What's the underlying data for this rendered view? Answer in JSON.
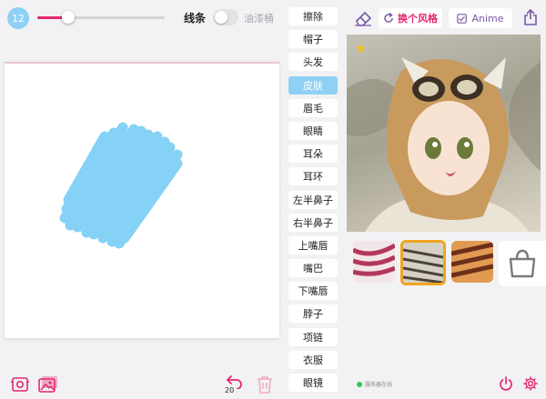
{
  "brush": {
    "size": "12",
    "size_fraction": 0.24,
    "accent": "#e4286e",
    "badge_color": "#8fd1f4"
  },
  "toolbar": {
    "lines_label": "线条",
    "paint_label": "油漆桶",
    "lines_toggle_on": false,
    "undo_count": "20"
  },
  "parts": {
    "active_index": 3,
    "items": [
      "擦除",
      "帽子",
      "头发",
      "皮肤",
      "眉毛",
      "眼睛",
      "耳朵",
      "耳环",
      "左半鼻子",
      "右半鼻子",
      "上嘴唇",
      "嘴巴",
      "下嘴唇",
      "脖子",
      "项链",
      "衣服",
      "眼镜"
    ]
  },
  "style_bar": {
    "change_style_label": "换个风格",
    "anime_label": "Anime"
  },
  "styles": {
    "selected_index": 1
  },
  "status": {
    "text": "服务器在线",
    "color": "#34c759"
  },
  "icons": {
    "top": [
      "eraser-icon",
      "refresh-icon",
      "checkbox-icon",
      "share-icon"
    ],
    "bottom": [
      "camera-icon",
      "gallery-icon",
      "undo-icon",
      "trash-icon",
      "power-icon",
      "gear-icon"
    ]
  }
}
